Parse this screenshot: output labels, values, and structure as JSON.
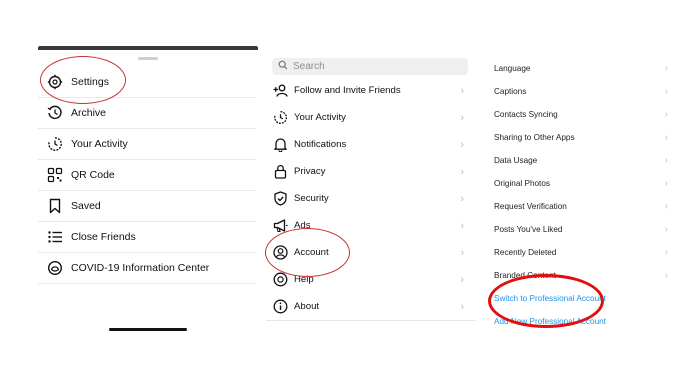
{
  "panel1": {
    "items": [
      {
        "label": "Settings",
        "icon": "settings-gear-icon"
      },
      {
        "label": "Archive",
        "icon": "archive-clock-icon"
      },
      {
        "label": "Your Activity",
        "icon": "activity-icon"
      },
      {
        "label": "QR Code",
        "icon": "qr-code-icon"
      },
      {
        "label": "Saved",
        "icon": "bookmark-icon"
      },
      {
        "label": "Close Friends",
        "icon": "close-friends-list-icon"
      },
      {
        "label": "COVID-19 Information Center",
        "icon": "covid-info-icon"
      }
    ]
  },
  "panel2": {
    "search_placeholder": "Search",
    "items": [
      {
        "label": "Follow and Invite Friends",
        "icon": "add-person-icon"
      },
      {
        "label": "Your Activity",
        "icon": "activity-icon"
      },
      {
        "label": "Notifications",
        "icon": "bell-icon"
      },
      {
        "label": "Privacy",
        "icon": "lock-icon"
      },
      {
        "label": "Security",
        "icon": "shield-icon"
      },
      {
        "label": "Ads",
        "icon": "megaphone-icon"
      },
      {
        "label": "Account",
        "icon": "account-circle-icon"
      },
      {
        "label": "Help",
        "icon": "help-icon"
      },
      {
        "label": "About",
        "icon": "info-icon"
      }
    ]
  },
  "panel3": {
    "items": [
      {
        "label": "Language"
      },
      {
        "label": "Captions"
      },
      {
        "label": "Contacts Syncing"
      },
      {
        "label": "Sharing to Other Apps"
      },
      {
        "label": "Data Usage"
      },
      {
        "label": "Original Photos"
      },
      {
        "label": "Request Verification"
      },
      {
        "label": "Posts You've Liked"
      },
      {
        "label": "Recently Deleted"
      },
      {
        "label": "Branded Content"
      }
    ],
    "links": [
      {
        "label": "Switch to Professional Account"
      },
      {
        "label": "Add New Professional Account"
      }
    ]
  },
  "colors": {
    "link": "#1a95e8",
    "highlight_circle": "#c8312f",
    "thick_circle": "#e01010"
  }
}
